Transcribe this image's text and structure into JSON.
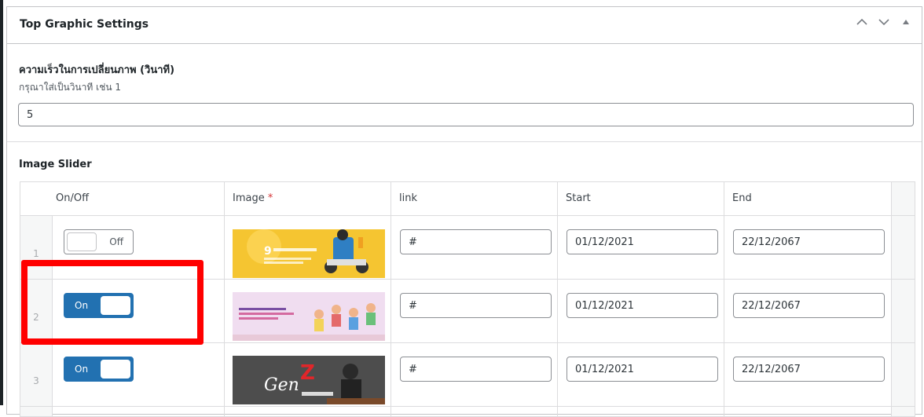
{
  "panel": {
    "title": "Top Graphic Settings"
  },
  "speed": {
    "label": "ความเร็วในการเปลี่ยนภาพ (วินาที)",
    "description": "กรุณาใส่เป็นวินาที เช่น 1",
    "value": "5"
  },
  "slider": {
    "label": "Image Slider",
    "columns": {
      "onoff": "On/Off",
      "image": "Image",
      "required_mark": "*",
      "link": "link",
      "start": "Start",
      "end": "End"
    },
    "rows": [
      {
        "num": "1",
        "toggle": "Off",
        "state": "off",
        "link": "#",
        "start": "01/12/2021",
        "end": "22/12/2067",
        "image_text": "9 ผลงาน ประกัน ไม่ต้องใช้ สุขภาพ"
      },
      {
        "num": "2",
        "toggle": "On",
        "state": "on",
        "link": "#",
        "start": "01/12/2021",
        "end": "22/12/2067",
        "image_text": "เติมเต็มความสุขของการเรียน"
      },
      {
        "num": "3",
        "toggle": "On",
        "state": "on",
        "link": "#",
        "start": "01/12/2021",
        "end": "22/12/2067",
        "image_text": "GenZ STRONG"
      }
    ]
  },
  "colors": {
    "accent": "#2271b1",
    "highlight": "#ff0000",
    "required": "#d63638"
  }
}
